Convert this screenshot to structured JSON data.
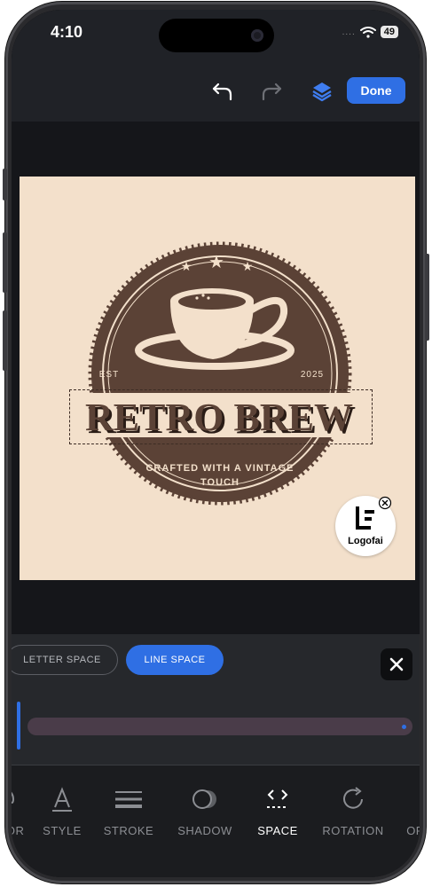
{
  "status_bar": {
    "time": "4:10",
    "signal": "....",
    "battery": "49"
  },
  "toolbar": {
    "done_label": "Done"
  },
  "logo": {
    "brand": "RETRO BREW",
    "est": "EST",
    "year": "2025",
    "tagline_1": "CRAFTED WITH A VINTAGE",
    "tagline_2": "TOUCH",
    "watermark": "Logofai"
  },
  "spacing_panel": {
    "letter_space_label": "LETTER SPACE",
    "line_space_label": "LINE SPACE",
    "active_tab": "LINE SPACE"
  },
  "tools": [
    {
      "label": "COLOR",
      "icon": "palette-icon"
    },
    {
      "label": "STYLE",
      "icon": "text-style-icon"
    },
    {
      "label": "STROKE",
      "icon": "stroke-icon"
    },
    {
      "label": "SHADOW",
      "icon": "shadow-icon"
    },
    {
      "label": "SPACE",
      "icon": "space-icon"
    },
    {
      "label": "ROTATION",
      "icon": "rotation-icon"
    },
    {
      "label": "OPACITY",
      "icon": "opacity-icon"
    }
  ],
  "colors": {
    "accent": "#2f6fe4",
    "logo_brown": "#5b4236",
    "cream": "#f3e0cb",
    "panel_bg": "#26282c"
  }
}
